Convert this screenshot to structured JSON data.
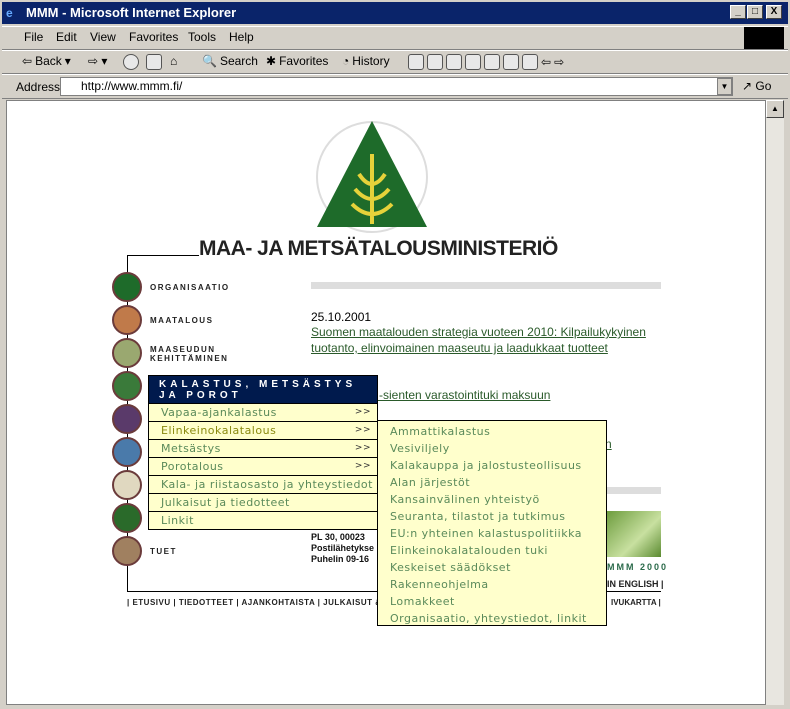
{
  "window": {
    "title": "MMM - Microsoft Internet Explorer",
    "min": "_",
    "max": "□",
    "close": "X"
  },
  "menubar": [
    "File",
    "Edit",
    "View",
    "Favorites",
    "Tools",
    "Help"
  ],
  "toolbar": {
    "back": "Back",
    "search": "Search",
    "favorites": "Favorites",
    "history": "History"
  },
  "address": {
    "label": "Address",
    "url": "http://www.mmm.fi/",
    "go": "Go"
  },
  "site": {
    "title": "MAA- JA METSÄTALOUSMINISTERIÖ",
    "nav": [
      {
        "label": "ORGANISAATIO",
        "color": "#1e6b2a"
      },
      {
        "label": "MAATALOUS",
        "color": "#c07a4a"
      },
      {
        "label": "MAASEUDUN KEHITTÄMINEN",
        "color": "#9aa870"
      },
      {
        "label": "",
        "color": "#3a7a3a"
      },
      {
        "label": "",
        "color": "#5a3a6a"
      },
      {
        "label": "",
        "color": "#4a7aaa"
      },
      {
        "label": "",
        "color": "#e0d8c0"
      },
      {
        "label": "",
        "color": "#2a6a2a"
      },
      {
        "label": "TUET",
        "color": "#a08060"
      }
    ],
    "news": {
      "date": "25.10.2001",
      "link1": "Suomen maatalouden strategia vuoteen 2010: Kilpailukykyinen tuotanto, elinvoimainen maaseutu ja laadukkaat tuotteet",
      "link2": "ien ja -sienten varastointituki maksuun",
      "link3": "n"
    },
    "contact": [
      "PL 30, 00023",
      "Postilähetykse",
      "Puhelin 09-16"
    ],
    "mmm2000": "MMM 2000",
    "english": "IN ENGLISH |",
    "footer_nav": "| ETUSIVU | TIEDOTTEET | AJANKOHTAISTA | JULKAISUT &",
    "footer_nav_right": "IVUKARTTA |"
  },
  "menu": {
    "header": "KALASTUS, METSÄSTYS JA POROT",
    "arrow": ">>",
    "items": [
      {
        "label": "Vapaa-ajankalastus",
        "sub": true
      },
      {
        "label": "Elinkeinokalatalous",
        "sub": true,
        "active": true
      },
      {
        "label": "Metsästys",
        "sub": true
      },
      {
        "label": "Porotalous",
        "sub": true
      },
      {
        "label": "Kala- ja riistaosasto ja yhteystiedot"
      },
      {
        "label": "Julkaisut ja tiedotteet"
      },
      {
        "label": "Linkit"
      }
    ]
  },
  "submenu": [
    "Ammattikalastus",
    "Vesiviljely",
    "Kalakauppa ja jalostusteollisuus",
    "Alan järjestöt",
    "Kansainvälinen yhteistyö",
    "Seuranta, tilastot ja tutkimus",
    "EU:n yhteinen kalastuspolitiikka",
    "Elinkeinokalatalouden tuki",
    "Keskeiset säädökset",
    "Rakenneohjelma",
    "Lomakkeet",
    "Organisaatio, yhteystiedot, linkit"
  ]
}
